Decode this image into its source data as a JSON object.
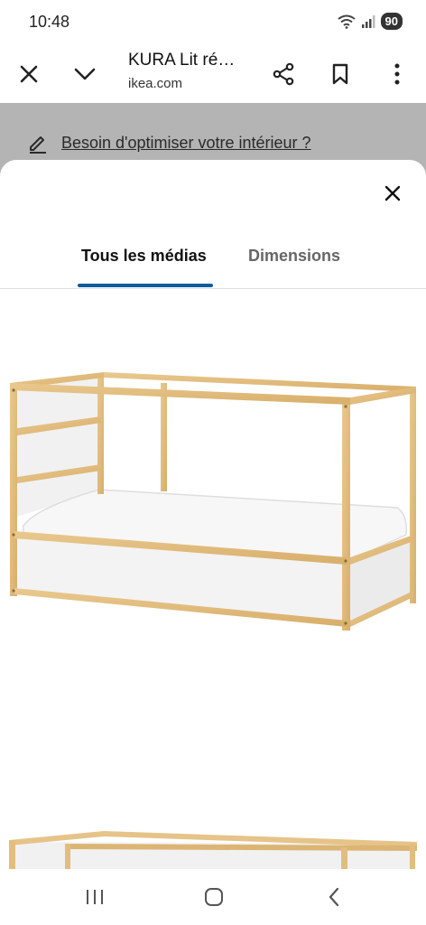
{
  "status_bar": {
    "time": "10:48",
    "battery": "90",
    "icons": [
      "wifi-icon",
      "signal-icon"
    ]
  },
  "browser": {
    "title": "KURA Lit ré…",
    "url": "ikea.com",
    "icons": [
      "close-icon",
      "chevron-down-icon",
      "share-icon",
      "bookmark-icon",
      "more-vert-icon"
    ]
  },
  "underlying_page": {
    "promo_text": "Besoin d'optimiser votre intérieur ?",
    "promo_icon": "pencil-icon"
  },
  "media_sheet": {
    "close_icon": "close-icon",
    "tabs": [
      {
        "label": "Tous les médias",
        "active": true
      },
      {
        "label": "Dimensions",
        "active": false
      }
    ],
    "accent_color": "#0f5c9c",
    "images": [
      "kura-bed-image",
      "kura-bed-image-second"
    ]
  },
  "nav_bar": {
    "icons": [
      "recents-icon",
      "home-icon",
      "back-icon"
    ]
  }
}
